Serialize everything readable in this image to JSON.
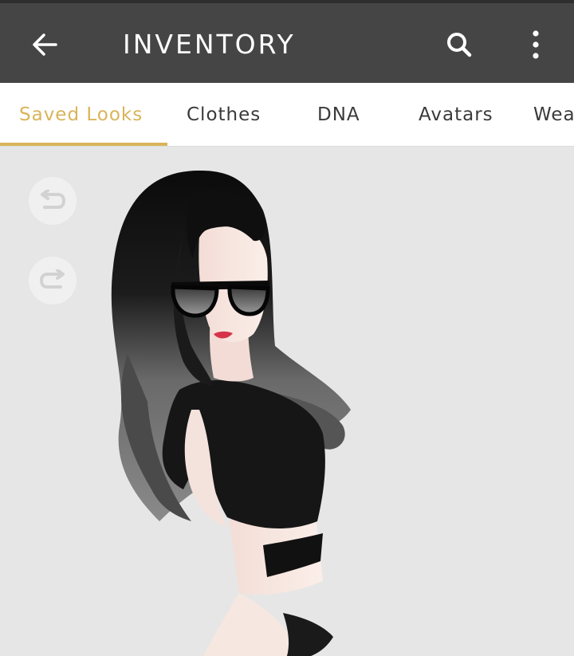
{
  "header": {
    "title": "INVENTORY",
    "back_icon": "arrow-left-icon",
    "search_icon": "search-icon",
    "more_icon": "more-vertical-icon"
  },
  "tabs": [
    {
      "label": "Saved Looks",
      "active": true
    },
    {
      "label": "Clothes",
      "active": false
    },
    {
      "label": "DNA",
      "active": false
    },
    {
      "label": "Avatars",
      "active": false
    },
    {
      "label": "Wea",
      "active": false
    }
  ],
  "viewport": {
    "undo_icon": "undo-icon",
    "redo_icon": "redo-icon"
  },
  "colors": {
    "header_bg": "#454545",
    "accent": "#d9b45a",
    "viewport_bg": "#e6e6e6"
  }
}
